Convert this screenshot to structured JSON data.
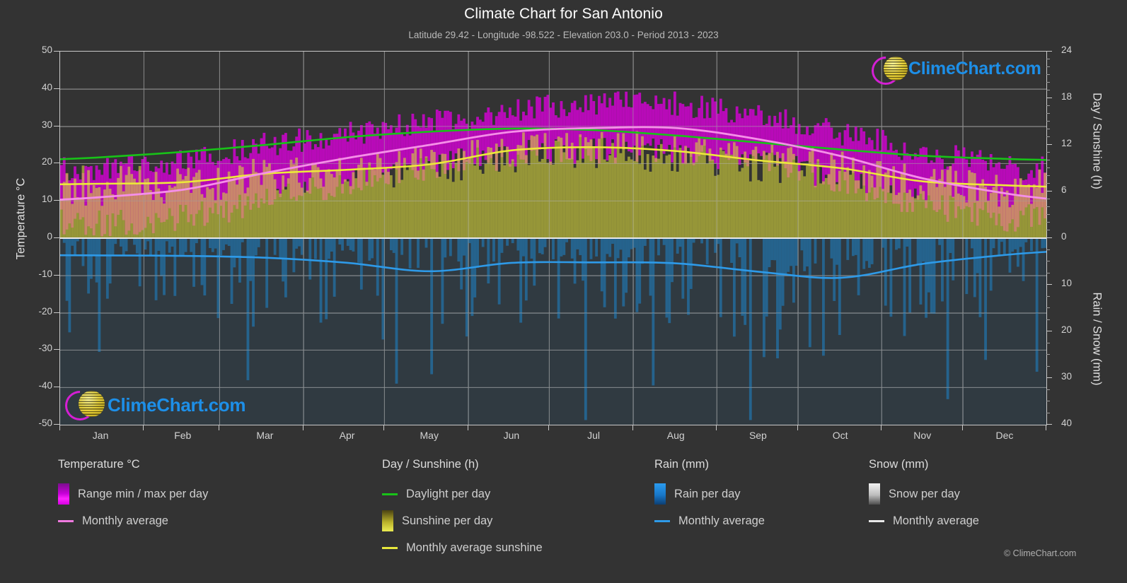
{
  "header": {
    "title": "Climate Chart for San Antonio",
    "subtitle": "Latitude 29.42 - Longitude -98.522 - Elevation 203.0 - Period 2013 - 2023"
  },
  "watermark": {
    "text": "ClimeChart.com",
    "logo_icon": "climechart-logo-icon"
  },
  "copyright": "© ClimeChart.com",
  "axes": {
    "left_title": "Temperature °C",
    "left_ticks": [
      "50",
      "40",
      "30",
      "20",
      "10",
      "0",
      "-10",
      "-20",
      "-30",
      "-40",
      "-50"
    ],
    "right_top_title": "Day / Sunshine (h)",
    "right_top_ticks": [
      "24",
      "18",
      "12",
      "6",
      "0"
    ],
    "right_bottom_title": "Rain / Snow (mm)",
    "right_bottom_ticks": [
      "0",
      "10",
      "20",
      "30",
      "40"
    ],
    "x_ticks": [
      "Jan",
      "Feb",
      "Mar",
      "Apr",
      "May",
      "Jun",
      "Jul",
      "Aug",
      "Sep",
      "Oct",
      "Nov",
      "Dec"
    ]
  },
  "legend": {
    "columns": [
      {
        "heading": "Temperature °C",
        "entries": [
          {
            "label": "Range min / max per day",
            "marker": "swatch",
            "color": "#d900d9"
          },
          {
            "label": "Monthly average",
            "marker": "line",
            "color": "#f07ae0"
          }
        ]
      },
      {
        "heading": "Day / Sunshine (h)",
        "entries": [
          {
            "label": "Daylight per day",
            "marker": "line",
            "color": "#18c218"
          },
          {
            "label": "Sunshine per day",
            "marker": "swatch",
            "color": "#e8e83c"
          },
          {
            "label": "Monthly average sunshine",
            "marker": "line",
            "color": "#e8e83c"
          }
        ]
      },
      {
        "heading": "Rain (mm)",
        "entries": [
          {
            "label": "Rain per day",
            "marker": "swatch",
            "color": "#1e8fe0"
          },
          {
            "label": "Monthly average",
            "marker": "line",
            "color": "#2e9ae8"
          }
        ]
      },
      {
        "heading": "Snow (mm)",
        "entries": [
          {
            "label": "Snow per day",
            "marker": "swatch",
            "color": "#e8e8e8"
          },
          {
            "label": "Monthly average",
            "marker": "line",
            "color": "#e8e8e8"
          }
        ]
      }
    ]
  },
  "colors": {
    "background": "#333333",
    "grid": "#6e6e6e",
    "axis": "#c9c9c9",
    "temp_range": "#d900d9",
    "temp_avg": "#f58fe8",
    "daylight": "#18c218",
    "sunshine_fill": "#a8a830",
    "sunshine_avg": "#ece83a",
    "rain_fill": "#1e7fc0",
    "rain_avg": "#2e9ae8",
    "snow": "#e8e8e8",
    "brand_blue": "#1d8fe8",
    "brand_magenta": "#d41fd4",
    "brand_yellow": "#e8d23a"
  },
  "chart_data": {
    "type": "area",
    "title": "Climate Chart for San Antonio",
    "subtitle": "Latitude 29.42 - Longitude -98.522 - Elevation 203.0 - Period 2013 - 2023",
    "xlabel": "",
    "ylabel": "Temperature °C",
    "ylim": [
      -50,
      50
    ],
    "y2_top_label": "Day / Sunshine (h)",
    "y2_top_lim": [
      0,
      24
    ],
    "y2_bottom_label": "Rain / Snow (mm)",
    "y2_bottom_lim": [
      0,
      40
    ],
    "grid": true,
    "legend_position": "below",
    "categories": [
      "Jan",
      "Feb",
      "Mar",
      "Apr",
      "May",
      "Jun",
      "Jul",
      "Aug",
      "Sep",
      "Oct",
      "Nov",
      "Dec"
    ],
    "series": [
      {
        "name": "Monthly average temperature",
        "unit": "°C",
        "color": "#f58fe8",
        "values": [
          11.0,
          13.0,
          17.5,
          21.5,
          25.0,
          28.5,
          29.5,
          29.5,
          26.5,
          22.0,
          16.0,
          12.0
        ]
      },
      {
        "name": "Monthly average sunshine",
        "unit": "h",
        "color": "#ece83a",
        "values": [
          7.0,
          7.2,
          8.3,
          8.8,
          9.5,
          11.3,
          11.7,
          11.2,
          10.0,
          9.0,
          7.3,
          6.8
        ]
      },
      {
        "name": "Daylight per day",
        "unit": "h",
        "color": "#18c218",
        "values": [
          10.4,
          11.1,
          12.0,
          13.0,
          13.7,
          14.1,
          13.9,
          13.2,
          12.3,
          11.4,
          10.6,
          10.2
        ]
      },
      {
        "name": "Monthly average rain",
        "unit": "mm",
        "color": "#2e9ae8",
        "values": [
          3.7,
          3.8,
          4.2,
          5.3,
          7.1,
          5.3,
          5.2,
          5.4,
          7.2,
          8.5,
          5.5,
          3.6
        ]
      },
      {
        "name": "Range min / max temperature per day",
        "unit": "°C",
        "color": "#d900d9",
        "min_values": [
          4.0,
          5.5,
          10.0,
          15.0,
          19.0,
          22.5,
          23.5,
          23.5,
          20.5,
          15.5,
          9.0,
          5.5
        ],
        "max_values": [
          18.5,
          20.5,
          25.0,
          28.0,
          31.0,
          34.5,
          36.0,
          36.0,
          32.5,
          28.0,
          23.0,
          19.0
        ]
      },
      {
        "name": "Monthly average snow",
        "unit": "mm",
        "color": "#e8e8e8",
        "values": [
          0,
          0,
          0,
          0,
          0,
          0,
          0,
          0,
          0,
          0,
          0,
          0
        ]
      }
    ]
  }
}
